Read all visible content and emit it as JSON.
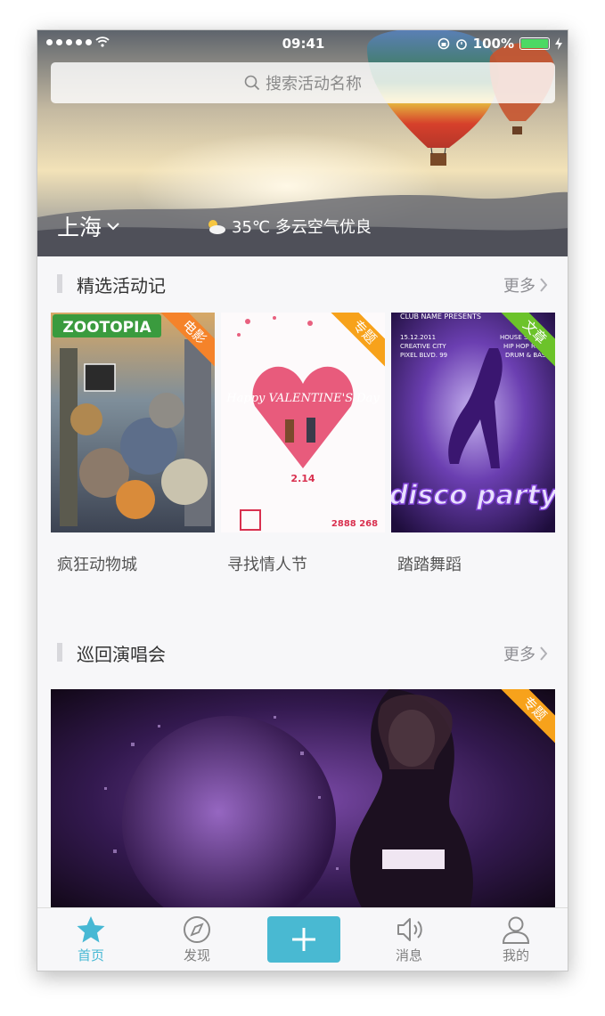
{
  "status_bar": {
    "time": "09:41",
    "battery": "100%"
  },
  "search": {
    "placeholder": "搜索活动名称"
  },
  "location": {
    "city": "上海"
  },
  "weather": {
    "text": "35℃ 多云空气优良"
  },
  "sections": {
    "featured": {
      "title": "精选活动记",
      "more": "更多",
      "cards": [
        {
          "title": "疯狂动物城",
          "tag": "电影",
          "tag_color": "#f5832a",
          "poster_text": "ZOOTOPIA"
        },
        {
          "title": "寻找情人节",
          "tag": "专题",
          "tag_color": "#f7a21b",
          "poster_text": "Happy VALENTINE'S Day",
          "poster_sub": "2.14",
          "poster_num": "2888 268"
        },
        {
          "title": "踏踏舞蹈",
          "tag": "文章",
          "tag_color": "#6cc32a",
          "poster_text": "disco party",
          "poster_club": "CLUB NAME PRESENTS",
          "poster_venue": "CREATIVE CITY",
          "poster_street": "PIXEL BLVD. 99",
          "poster_date": "15.12.2011",
          "poster_session": "HOUSE SESSION",
          "poster_genre": "HIP HOP R&B",
          "poster_genre2": "DRUM & BASS"
        }
      ]
    },
    "tour": {
      "title": "巡回演唱会",
      "more": "更多",
      "tag": "专题",
      "tag_color": "#f7a21b"
    }
  },
  "tabbar": {
    "items": [
      {
        "label": "首页",
        "icon": "star-icon",
        "active": true
      },
      {
        "label": "发现",
        "icon": "compass-icon",
        "active": false
      },
      {
        "label": "",
        "icon": "plus-icon",
        "active": false
      },
      {
        "label": "消息",
        "icon": "speaker-icon",
        "active": false
      },
      {
        "label": "我的",
        "icon": "person-icon",
        "active": false
      }
    ],
    "active_color": "#47b8d4",
    "accent_color": "#49b9d2"
  }
}
